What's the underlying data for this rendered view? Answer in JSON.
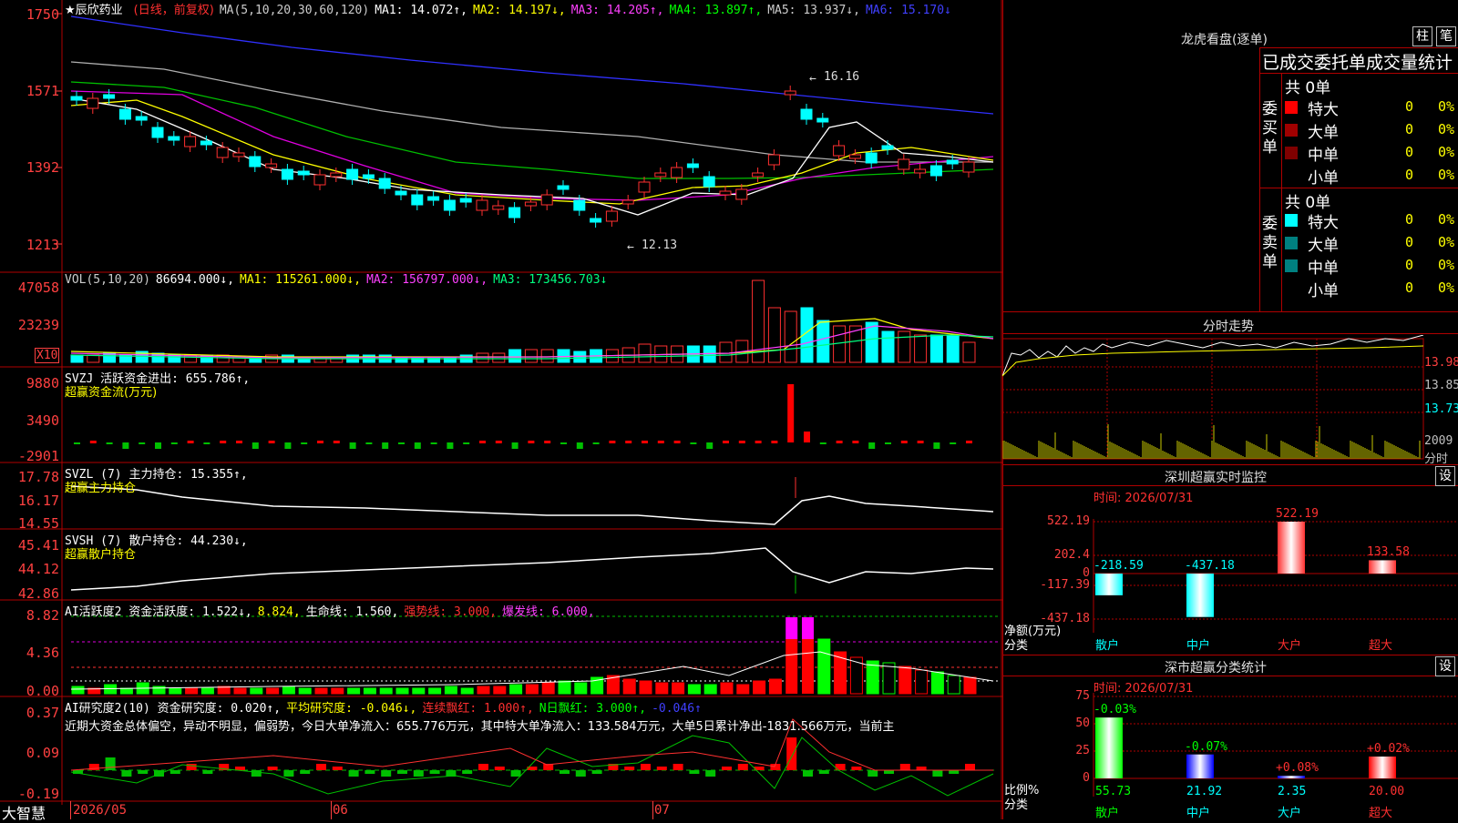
{
  "stock": {
    "name": "辰欣药业",
    "mode": "(日线，前复权)",
    "ma_label": "MA(5,10,20,30,60,120)",
    "ma1": "MA1: 14.072↑,",
    "ma2": "MA2: 14.197↓,",
    "ma3": "MA3: 14.205↑,",
    "ma4": "MA4: 13.897↑,",
    "ma5": "MA5: 13.937↓,",
    "ma6": "MA6: 15.170↓",
    "high_mark": "16.16",
    "low_mark": "12.13",
    "y_ticks": [
      "1750",
      "1571",
      "1392",
      "1213"
    ]
  },
  "vol": {
    "label": "VOL(5,10,20)",
    "val": "86694.000↓,",
    "ma1": "MA1: 115261.000↓,",
    "ma2": "MA2: 156797.000↓,",
    "ma3": "MA3: 173456.703↓",
    "y_ticks": [
      "47058",
      "23239"
    ],
    "unit": "X10"
  },
  "svzj": {
    "label": "SVZJ  活跃资金进出: 655.786↑,",
    "sub": "超赢资金流(万元)",
    "y_ticks": [
      "9880",
      "3490",
      "-2901"
    ]
  },
  "svzl": {
    "label": "SVZL (7) 主力持仓: 15.355↑,",
    "sub": "超赢主力持仓",
    "y_ticks": [
      "17.78",
      "16.17",
      "14.55"
    ]
  },
  "svsh": {
    "label": "SVSH (7) 散户持仓: 44.230↓,",
    "sub": "超赢散户持仓",
    "y_ticks": [
      "45.41",
      "44.12",
      "42.86"
    ]
  },
  "ai1": {
    "label": "AI活跃度2 资金活跃度: 1.522↓,",
    "v2": "8.824,",
    "v3": "生命线: 1.560,",
    "v4": "强势线: 3.000,",
    "v5": "爆发线: 6.000,",
    "y_ticks": [
      "8.82",
      "4.36",
      "0.00"
    ]
  },
  "ai2": {
    "label": "AI研究度2(10) 资金研究度: 0.020↑,",
    "v2": "平均研究度: -0.046↓,",
    "v3": "连续飘红: 1.000↑,",
    "v4": "N日飘红: 3.000↑,",
    "v5": "-0.046↑",
    "text": "近期大资金总体偏空，异动不明显，偏弱势，今日大单净流入：655.776万元，其中特大单净流入：133.584万元，大单5日累计净出-1831.566万元，当前主",
    "y_ticks": [
      "0.37",
      "0.09",
      "-0.19"
    ]
  },
  "xaxis": {
    "brand": "大智慧",
    "labels": [
      "2026/05",
      "06",
      "07"
    ]
  },
  "lhb": {
    "title": "龙虎看盘(逐单)",
    "btn1": "柱",
    "btn2": "笔",
    "header": "已成交委托单成交量统计",
    "buy_total": "共 0单",
    "sell_total": "共 0单",
    "buy_label": "委买单",
    "sell_label": "委卖单",
    "rows": [
      "特大",
      "大单",
      "中单",
      "小单"
    ],
    "zero": "0",
    "pct": "0%"
  },
  "fenshi": {
    "title": "分时走势",
    "ticks": [
      "13.98",
      "13.85",
      "13.73",
      "2009",
      "分时"
    ]
  },
  "sz_monitor": {
    "title": "深圳超赢实时监控",
    "btn": "设",
    "time": "时间: 2026/07/31",
    "y_ticks": [
      "522.19",
      "202.4",
      "0",
      "-117.39",
      "-437.18"
    ],
    "bars": [
      {
        "label": "散户",
        "value": "-218.59"
      },
      {
        "label": "中户",
        "value": "-437.18"
      },
      {
        "label": "大户",
        "value": "522.19"
      },
      {
        "label": "超大",
        "value": "133.58"
      }
    ],
    "axis_label": "净额(万元)",
    "cat_label": "分类"
  },
  "sz_class": {
    "title": "深市超赢分类统计",
    "btn": "设",
    "time": "时间: 2026/07/31",
    "y_ticks": [
      "75",
      "50",
      "25",
      "0"
    ],
    "bars": [
      {
        "label": "散户",
        "value": "55.73",
        "delta": "-0.03%"
      },
      {
        "label": "中户",
        "value": "21.92",
        "delta": "-0.07%"
      },
      {
        "label": "大户",
        "value": "2.35",
        "delta": "+0.08%"
      },
      {
        "label": "超大",
        "value": "20.00",
        "delta": "+0.02%"
      }
    ],
    "axis_label": "比例%",
    "cat_label": "分类"
  },
  "colors": {
    "red": "#ff3030",
    "cyan": "#00ffff",
    "yellow": "#ffff00",
    "green": "#00ff00",
    "magenta": "#ff00ff"
  }
}
